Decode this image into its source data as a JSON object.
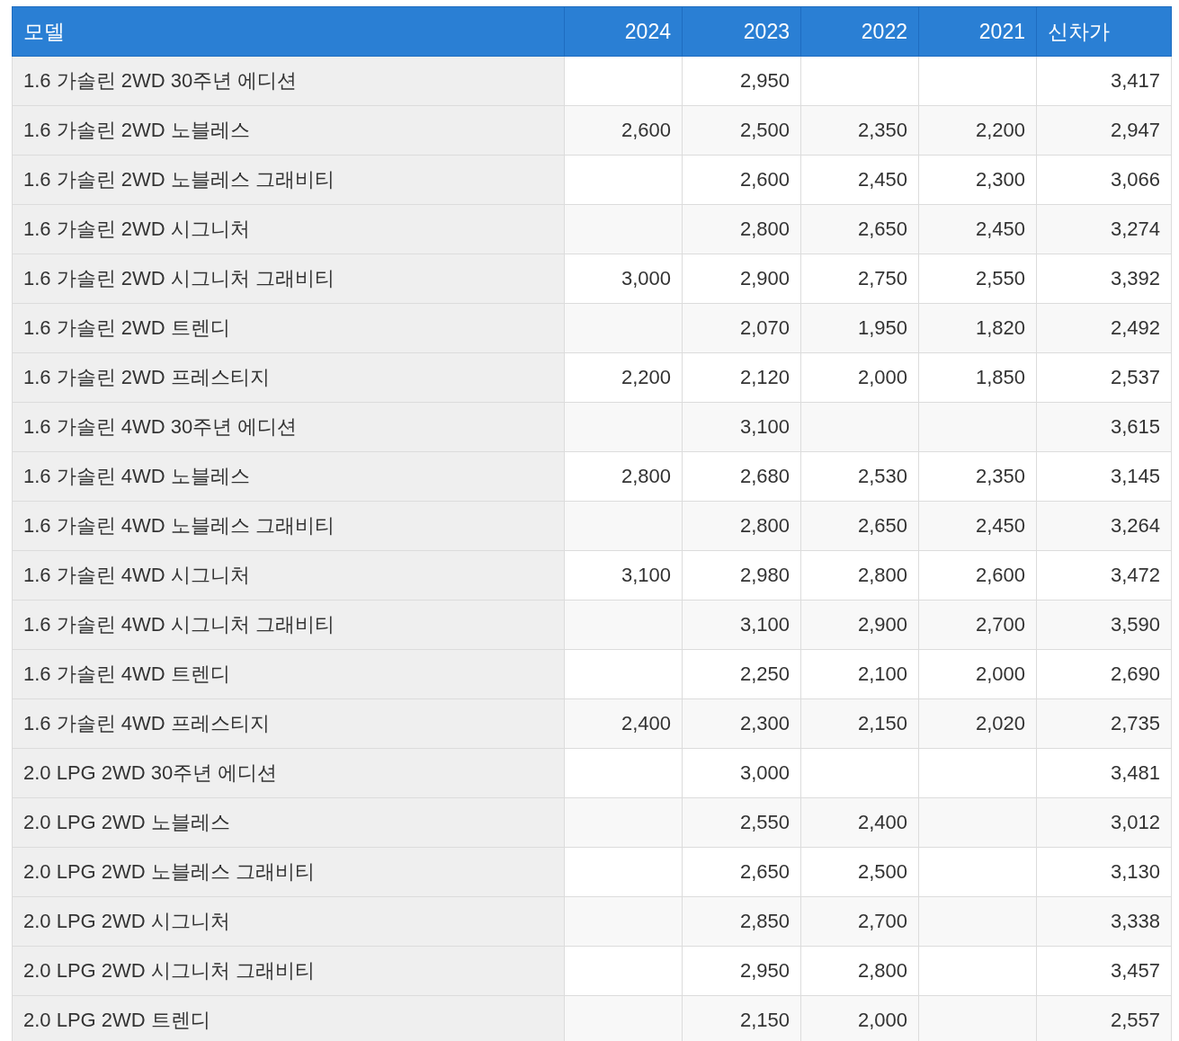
{
  "table": {
    "columns": [
      "모델",
      "2024",
      "2023",
      "2022",
      "2021",
      "신차가"
    ],
    "rows": [
      {
        "model": "1.6 가솔린 2WD 30주년 에디션",
        "y2023": "2,950",
        "new_price": "3,417"
      },
      {
        "model": "1.6 가솔린 2WD 노블레스",
        "y2024": "2,600",
        "y2023": "2,500",
        "y2022": "2,350",
        "y2021": "2,200",
        "new_price": "2,947"
      },
      {
        "model": "1.6 가솔린 2WD 노블레스 그래비티",
        "y2023": "2,600",
        "y2022": "2,450",
        "y2021": "2,300",
        "new_price": "3,066"
      },
      {
        "model": "1.6 가솔린 2WD 시그니처",
        "y2023": "2,800",
        "y2022": "2,650",
        "y2021": "2,450",
        "new_price": "3,274"
      },
      {
        "model": "1.6 가솔린 2WD 시그니처 그래비티",
        "y2024": "3,000",
        "y2023": "2,900",
        "y2022": "2,750",
        "y2021": "2,550",
        "new_price": "3,392"
      },
      {
        "model": "1.6 가솔린 2WD 트렌디",
        "y2023": "2,070",
        "y2022": "1,950",
        "y2021": "1,820",
        "new_price": "2,492"
      },
      {
        "model": "1.6 가솔린 2WD 프레스티지",
        "y2024": "2,200",
        "y2023": "2,120",
        "y2022": "2,000",
        "y2021": "1,850",
        "new_price": "2,537"
      },
      {
        "model": "1.6 가솔린 4WD 30주년 에디션",
        "y2023": "3,100",
        "new_price": "3,615"
      },
      {
        "model": "1.6 가솔린 4WD 노블레스",
        "y2024": "2,800",
        "y2023": "2,680",
        "y2022": "2,530",
        "y2021": "2,350",
        "new_price": "3,145"
      },
      {
        "model": "1.6 가솔린 4WD 노블레스 그래비티",
        "y2023": "2,800",
        "y2022": "2,650",
        "y2021": "2,450",
        "new_price": "3,264"
      },
      {
        "model": "1.6 가솔린 4WD 시그니처",
        "y2024": "3,100",
        "y2023": "2,980",
        "y2022": "2,800",
        "y2021": "2,600",
        "new_price": "3,472"
      },
      {
        "model": "1.6 가솔린 4WD 시그니처 그래비티",
        "y2023": "3,100",
        "y2022": "2,900",
        "y2021": "2,700",
        "new_price": "3,590"
      },
      {
        "model": "1.6 가솔린 4WD 트렌디",
        "y2023": "2,250",
        "y2022": "2,100",
        "y2021": "2,000",
        "new_price": "2,690"
      },
      {
        "model": "1.6 가솔린 4WD 프레스티지",
        "y2024": "2,400",
        "y2023": "2,300",
        "y2022": "2,150",
        "y2021": "2,020",
        "new_price": "2,735"
      },
      {
        "model": "2.0 LPG 2WD 30주년 에디션",
        "y2023": "3,000",
        "new_price": "3,481"
      },
      {
        "model": "2.0 LPG 2WD 노블레스",
        "y2023": "2,550",
        "y2022": "2,400",
        "new_price": "3,012"
      },
      {
        "model": "2.0 LPG 2WD 노블레스 그래비티",
        "y2023": "2,650",
        "y2022": "2,500",
        "new_price": "3,130"
      },
      {
        "model": "2.0 LPG 2WD 시그니처",
        "y2023": "2,850",
        "y2022": "2,700",
        "new_price": "3,338"
      },
      {
        "model": "2.0 LPG 2WD 시그니처 그래비티",
        "y2023": "2,950",
        "y2022": "2,800",
        "new_price": "3,457"
      },
      {
        "model": "2.0 LPG 2WD 트렌디",
        "y2023": "2,150",
        "y2022": "2,000",
        "new_price": "2,557"
      }
    ]
  }
}
